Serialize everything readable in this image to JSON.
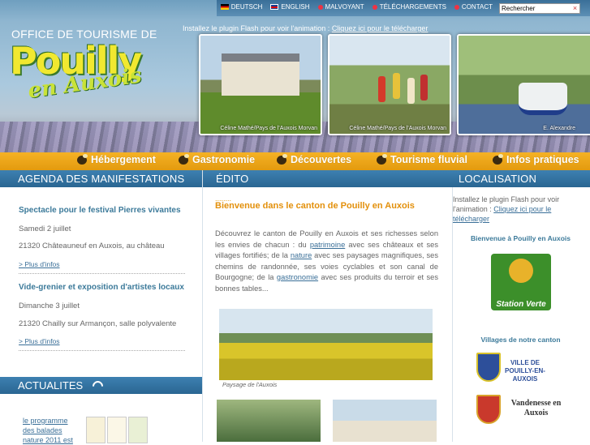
{
  "header": {
    "brand_top": "OFFICE DE TOURISME DE",
    "brand_main": "Pouilly",
    "brand_sub": "en Auxois",
    "flash_text": "Installez le plugin Flash pour voir l'animation : ",
    "flash_link": "Cliquez ici pour le télécharger",
    "toplinks": [
      {
        "label": "DEUTSCH",
        "icon": "flag-de-icon"
      },
      {
        "label": "ENGLISH",
        "icon": "flag-uk-icon"
      },
      {
        "label": "MALVOYANT",
        "icon": "accessibility-icon"
      },
      {
        "label": "TÉLÉCHARGEMENTS",
        "icon": "download-icon"
      },
      {
        "label": "CONTACT",
        "icon": "mail-icon"
      }
    ],
    "search_placeholder": "Rechercher",
    "search_go": "×",
    "photos": [
      {
        "caption": "Céline Mathé/Pays de l'Auxois Morvan"
      },
      {
        "caption": "Céline Mathé/Pays de l'Auxois Morvan"
      },
      {
        "caption": "E. Alexandre"
      }
    ]
  },
  "nav": {
    "items": [
      "Hébergement",
      "Gastronomie",
      "Découvertes",
      "Tourisme fluvial",
      "Infos pratiques"
    ]
  },
  "agenda": {
    "title": "AGENDA DES MANIFESTATIONS",
    "events": [
      {
        "title": "Spectacle pour le festival Pierres vivantes",
        "date": "Samedi 2 juillet",
        "place": "21320 Châteauneuf en Auxois, au château",
        "more": "> Plus d'infos"
      },
      {
        "title": "Vide-grenier et exposition d'artistes locaux",
        "date": " Dimanche 3 juillet",
        "place": "21320 Chailly sur Armançon, salle polyvalente",
        "more": "> Plus d'infos"
      }
    ]
  },
  "actualites": {
    "title": "ACTUALITES",
    "link": "le programme des balades nature 2011 est"
  },
  "edito": {
    "title": "ÉDITO",
    "dots": "........",
    "heading": "Bienvenue dans le canton de Pouilly en Auxois",
    "text_1": "Découvrez le canton de Pouilly en Auxois et ses richesses selon les envies de chacun : du ",
    "link_1": "patrimoine",
    "text_2": " avec ses châteaux et ses villages fortifiés; de la ",
    "link_2": "nature",
    "text_3": " avec ses paysages magnifiques, ses chemins de randonnée, ses voies cyclables et son canal de Bourgogne; de la ",
    "link_3": "gastronomie",
    "text_4": " avec ses produits du terroir et ses bonnes tables...",
    "photo_caption": "Paysage de l'Auxois"
  },
  "localisation": {
    "title": "LOCALISATION",
    "flash_text": "Installez le plugin Flash pour voir l'animation : ",
    "flash_link": "Cliquez ici pour le télécharger",
    "welcome": "Bienvenue à Pouilly en Auxois",
    "station_label": "Station Verte",
    "villages_title": "Villages de notre canton",
    "village_1": "VILLE DE POUILLY-EN-AUXOIS",
    "village_2": "Vandenesse en Auxois"
  },
  "colors": {
    "accent_orange": "#f5b225",
    "header_blue": "#2a6692",
    "link_blue": "#3a6f98",
    "title_orange": "#e3900b"
  }
}
